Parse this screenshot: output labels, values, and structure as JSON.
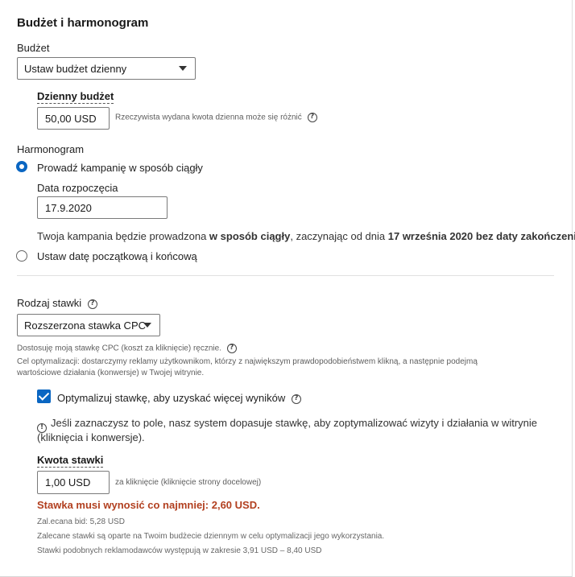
{
  "section": {
    "title": "Budżet i harmonogram"
  },
  "budget": {
    "label": "Budżet",
    "select_value": "Ustaw budżet dzienny",
    "daily_label": "Dzienny budżet",
    "daily_value": "50,00 USD",
    "daily_note": "Rzeczywista wydana kwota dzienna może się różnić",
    "help_icon": "?"
  },
  "schedule": {
    "label": "Harmonogram",
    "option_continuous": "Prowadź kampanię w sposób ciągły",
    "start_date_label": "Data rozpoczęcia",
    "start_date_value": "17.9.2020",
    "summary_prefix": "Twoja kampania będzie prowadzona ",
    "summary_bold1": "w sposób ciągły",
    "summary_mid": ", zaczynając od dnia ",
    "summary_bold2": "17 września 2020",
    "summary_bold3": " bez daty zakończenia.",
    "option_range": "Ustaw datę początkową i końcową"
  },
  "bid": {
    "label": "Rodzaj stawki",
    "select_value": "Rozszerzona stawka CPC",
    "desc_line1": "Dostosuję moją stawkę CPC (koszt za kliknięcie) ręcznie.",
    "desc_line2": "Cel optymalizacji: dostarczymy reklamy użytkownikom, którzy z największym prawdopodobieństwem klikną, a następnie podejmą",
    "desc_line3": "wartościowe działania (konwersje) w Twojej witrynie.",
    "optimize_label": "Optymalizuj stawkę, aby uzyskać więcej wyników",
    "optimize_note_line1": "Jeśli zaznaczysz to pole, nasz system dopasuje stawkę, aby zoptymalizować wizyty i działania w witrynie",
    "optimize_note_line2": "(kliknięcia i konwersje).",
    "amount_label": "Kwota stawki",
    "amount_value": "1,00 USD",
    "amount_unit": "za kliknięcie (kliknięcie strony docelowej)",
    "error": "Stawka musi wynosić co najmniej: 2,60 USD.",
    "recommended": "Zal.ecana bid: 5,28 USD",
    "recommended_note": "Zalecane stawki są oparte na Twoim budżecie dziennym w celu optymalizacji jego wykorzystania.",
    "similar": "Stawki podobnych reklamodawców występują w zakresie 3,91 USD – 8,40 USD",
    "info_icon": "!"
  },
  "colors": {
    "accent": "#0a66c2",
    "error": "#b24020"
  }
}
